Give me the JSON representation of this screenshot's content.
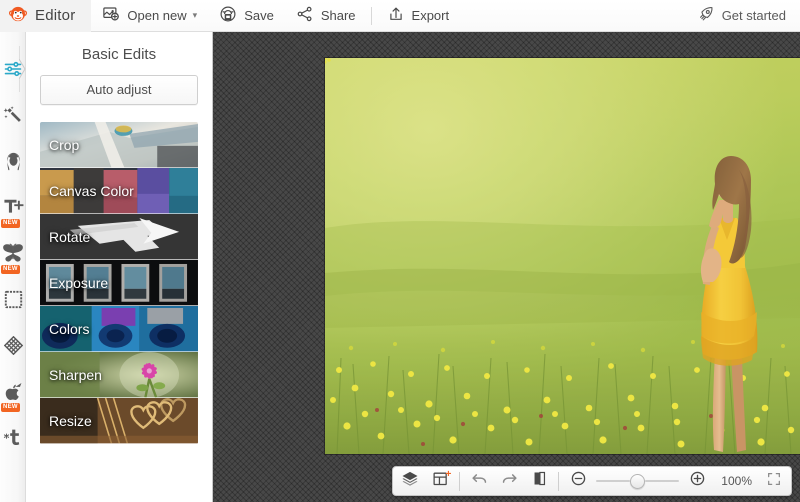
{
  "app": {
    "name": "Editor",
    "accent_orange": "#f26522",
    "accent_blue": "#2aa8c8",
    "canvas_bg": "#3b3b3b"
  },
  "header": {
    "logo_icon": "monkey-logo-icon",
    "logo_text": "Editor",
    "items": [
      {
        "id": "open-new",
        "label": "Open new",
        "icon": "image-add-icon",
        "caret": "⌄",
        "has_caret": true
      },
      {
        "id": "save",
        "label": "Save",
        "icon": "save-disk-icon",
        "has_caret": false
      },
      {
        "id": "share",
        "label": "Share",
        "icon": "share-nodes-icon",
        "has_caret": false
      },
      {
        "id": "export",
        "label": "Export",
        "icon": "export-upload-icon",
        "has_caret": false
      }
    ],
    "get_started": {
      "label": "Get started",
      "icon": "rocket-icon"
    }
  },
  "rail": {
    "items": [
      {
        "id": "basic-edits",
        "icon": "sliders-icon",
        "active": true,
        "badge": ""
      },
      {
        "id": "effects",
        "icon": "magic-wand-icon",
        "active": false,
        "badge": ""
      },
      {
        "id": "touch-up",
        "icon": "face-portrait-icon",
        "active": false,
        "badge": ""
      },
      {
        "id": "text",
        "icon": "text-tool-icon",
        "active": false,
        "badge": "NEW"
      },
      {
        "id": "overlays",
        "icon": "butterfly-icon",
        "active": false,
        "badge": "NEW"
      },
      {
        "id": "frames",
        "icon": "frame-icon",
        "active": false,
        "badge": ""
      },
      {
        "id": "textures",
        "icon": "texture-mesh-icon",
        "active": false,
        "badge": ""
      },
      {
        "id": "themes",
        "icon": "apple-arrow-icon",
        "active": false,
        "badge": "NEW"
      },
      {
        "id": "design",
        "icon": "snowflake-t-icon",
        "active": false,
        "badge": ""
      }
    ]
  },
  "panel": {
    "title": "Basic Edits",
    "auto_adjust_label": "Auto adjust",
    "edits": [
      {
        "id": "crop",
        "label": "Crop"
      },
      {
        "id": "canvas-color",
        "label": "Canvas Color"
      },
      {
        "id": "rotate",
        "label": "Rotate"
      },
      {
        "id": "exposure",
        "label": "Exposure"
      },
      {
        "id": "colors",
        "label": "Colors"
      },
      {
        "id": "sharpen",
        "label": "Sharpen"
      },
      {
        "id": "resize",
        "label": "Resize"
      }
    ]
  },
  "canvas": {
    "photo_alt": "Woman in yellow dress standing in a green meadow of yellow flowers"
  },
  "bottombar": {
    "buttons": [
      {
        "id": "layers",
        "icon": "layers-icon",
        "badge": ""
      },
      {
        "id": "collage",
        "icon": "collage-add-icon",
        "badge": "+"
      },
      {
        "id": "undo",
        "icon": "undo-arrow-icon",
        "badge": ""
      },
      {
        "id": "redo",
        "icon": "redo-arrow-icon",
        "badge": ""
      },
      {
        "id": "compare",
        "icon": "compare-split-icon",
        "badge": ""
      }
    ],
    "zoom_out_icon": "zoom-out-icon",
    "zoom_in_icon": "zoom-in-icon",
    "zoom_value": "100%",
    "fullscreen_icon": "fullscreen-icon"
  }
}
